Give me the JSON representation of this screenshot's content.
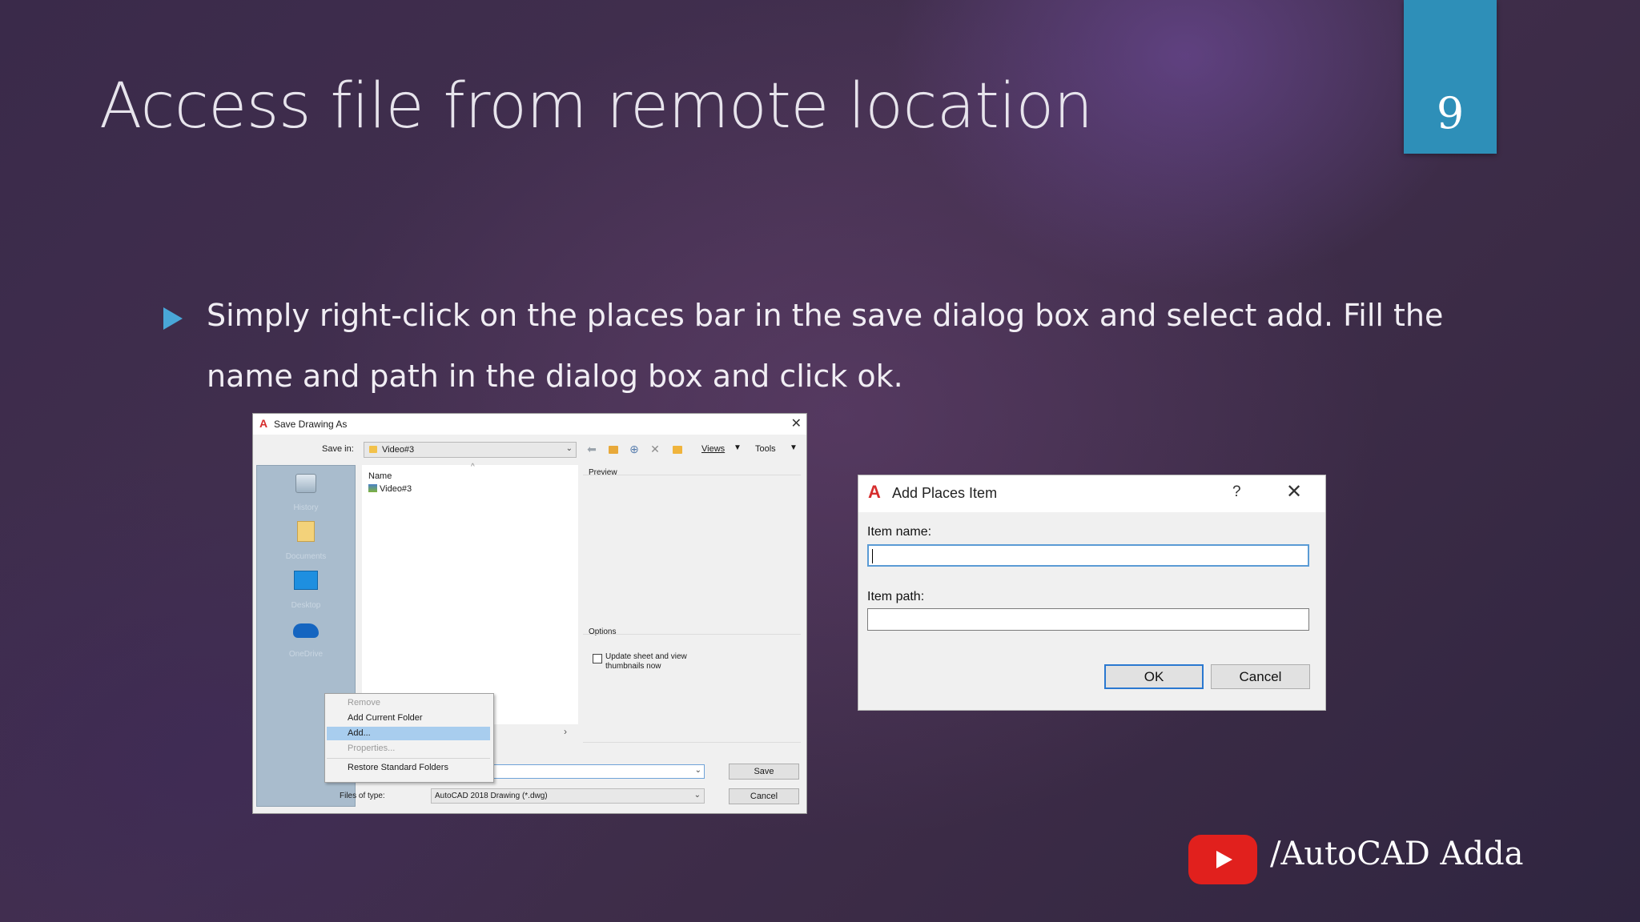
{
  "slide": {
    "title": "Access file from remote location",
    "number": "9",
    "bullet_line1": "Simply right-click on the places bar in the save dialog box and select add. Fill the",
    "bullet_line2": "name and path in the dialog box and click ok."
  },
  "save_dialog": {
    "logo": "A",
    "title": "Save Drawing As",
    "close_glyph": "✕",
    "save_in_label": "Save in:",
    "save_in_value": "Video#3",
    "views_label": "Views",
    "tools_label": "Tools",
    "places": [
      {
        "label": "History"
      },
      {
        "label": "Documents"
      },
      {
        "label": "Desktop"
      },
      {
        "label": "OneDrive"
      }
    ],
    "column_name": "Name",
    "sort_caret": "^",
    "file_item": "Video#3",
    "preview_label": "Preview",
    "options_label": "Options",
    "update_checkbox_label": "Update sheet and view thumbnails now",
    "scroll_arrow": "›",
    "files_type_label": "Files of type:",
    "files_type_value": "AutoCAD 2018 Drawing (*.dwg)",
    "save_button": "Save",
    "cancel_button": "Cancel",
    "context_menu": [
      {
        "label": "Remove",
        "state": "disabled"
      },
      {
        "label": "Add Current Folder",
        "state": "normal"
      },
      {
        "label": "Add...",
        "state": "selected"
      },
      {
        "label": "Properties...",
        "state": "disabled"
      },
      {
        "label": "Restore Standard Folders",
        "state": "normal"
      }
    ]
  },
  "places_dialog": {
    "logo": "A",
    "title": "Add Places Item",
    "help_glyph": "?",
    "close_glyph": "✕",
    "item_name_label": "Item name:",
    "item_name_value": "",
    "item_path_label": "Item path:",
    "item_path_value": "",
    "ok_button": "OK",
    "cancel_button": "Cancel"
  },
  "branding": {
    "channel": "/AutoCAD Adda"
  },
  "colors": {
    "accent": "#2e8fb8",
    "bullet": "#49a7d8",
    "youtube_red": "#e1201d",
    "menu_highlight": "#a8cdee"
  }
}
